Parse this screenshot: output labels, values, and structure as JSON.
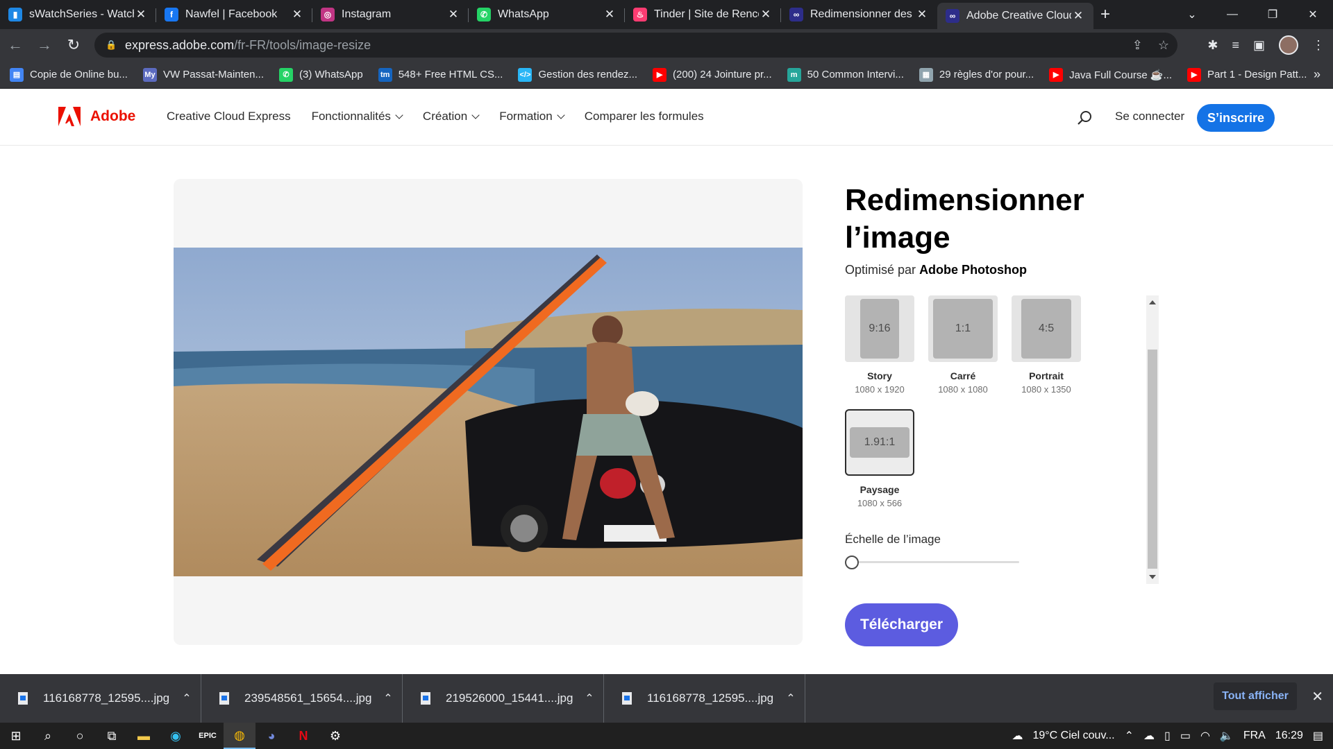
{
  "browser": {
    "tabs": [
      {
        "title": "sWatchSeries - Watch",
        "icon": "swatchseries-icon",
        "color": "#1e88e5",
        "glyph": "▮"
      },
      {
        "title": "Nawfel | Facebook",
        "icon": "facebook-icon",
        "color": "#1877f2",
        "glyph": "f"
      },
      {
        "title": "Instagram",
        "icon": "instagram-icon",
        "color": "#c13584",
        "glyph": "◎"
      },
      {
        "title": "WhatsApp",
        "icon": "whatsapp-icon",
        "color": "#25d366",
        "glyph": "✆"
      },
      {
        "title": "Tinder | Site de Renco",
        "icon": "tinder-icon",
        "color": "#fe3c72",
        "glyph": "♨"
      },
      {
        "title": "Redimensionner des i",
        "icon": "adobe-cc-icon",
        "color": "#2d2d8a",
        "glyph": "∞"
      },
      {
        "title": "Adobe Creative Cloud",
        "icon": "adobe-cc-icon",
        "color": "#2d2d8a",
        "glyph": "∞"
      }
    ],
    "url_host": "express.adobe.com",
    "url_path": "/fr-FR/tools/image-resize",
    "bookmarks": [
      {
        "label": "Copie de Online bu...",
        "color": "#4285f4",
        "glyph": "▤"
      },
      {
        "label": "VW Passat-Mainten...",
        "color": "#5c6bc0",
        "glyph": "My"
      },
      {
        "label": "(3) WhatsApp",
        "color": "#25d366",
        "glyph": "✆"
      },
      {
        "label": "548+ Free HTML CS...",
        "color": "#1565c0",
        "glyph": "tm"
      },
      {
        "label": "Gestion des rendez...",
        "color": "#29b6f6",
        "glyph": "</>"
      },
      {
        "label": "(200) 24 Jointure pr...",
        "color": "#ff0000",
        "glyph": "▶"
      },
      {
        "label": "50 Common Intervi...",
        "color": "#26a69a",
        "glyph": "m"
      },
      {
        "label": "29 règles d'or pour...",
        "color": "#90a4ae",
        "glyph": "▦"
      },
      {
        "label": "Java Full Course ☕...",
        "color": "#ff0000",
        "glyph": "▶"
      },
      {
        "label": "Part 1 - Design Patt...",
        "color": "#ff0000",
        "glyph": "▶"
      }
    ]
  },
  "site": {
    "brand": "Adobe",
    "nav": [
      {
        "label": "Creative Cloud Express",
        "dropdown": false
      },
      {
        "label": "Fonctionnalités",
        "dropdown": true
      },
      {
        "label": "Création",
        "dropdown": true
      },
      {
        "label": "Formation",
        "dropdown": true
      },
      {
        "label": "Comparer les formules",
        "dropdown": false
      }
    ],
    "login": "Se connecter",
    "signup": "S’inscrire"
  },
  "tool": {
    "title_line1": "Redimensionner",
    "title_line2": "l’image",
    "powered_prefix": "Optimisé par",
    "powered_by": "Adobe Photoshop",
    "ratios": [
      {
        "ratio": "9:16",
        "name": "Story",
        "dims": "1080 x 1920",
        "selected": false
      },
      {
        "ratio": "1:1",
        "name": "Carré",
        "dims": "1080 x 1080",
        "selected": false
      },
      {
        "ratio": "4:5",
        "name": "Portrait",
        "dims": "1080 x 1350",
        "selected": false
      },
      {
        "ratio": "1.91:1",
        "name": "Paysage",
        "dims": "1080 x 566",
        "selected": true
      }
    ],
    "scale_label": "Échelle de l’image",
    "scale_value": 0,
    "download": "Télécharger",
    "accent": "#5c5ce0"
  },
  "downloads": {
    "files": [
      "116168778_12595....jpg",
      "239548561_15654....jpg",
      "219526000_15441....jpg",
      "116168778_12595....jpg"
    ],
    "show_all": "Tout afficher"
  },
  "taskbar": {
    "weather": "19°C  Ciel couv...",
    "lang": "FRA",
    "time": "16:29"
  }
}
